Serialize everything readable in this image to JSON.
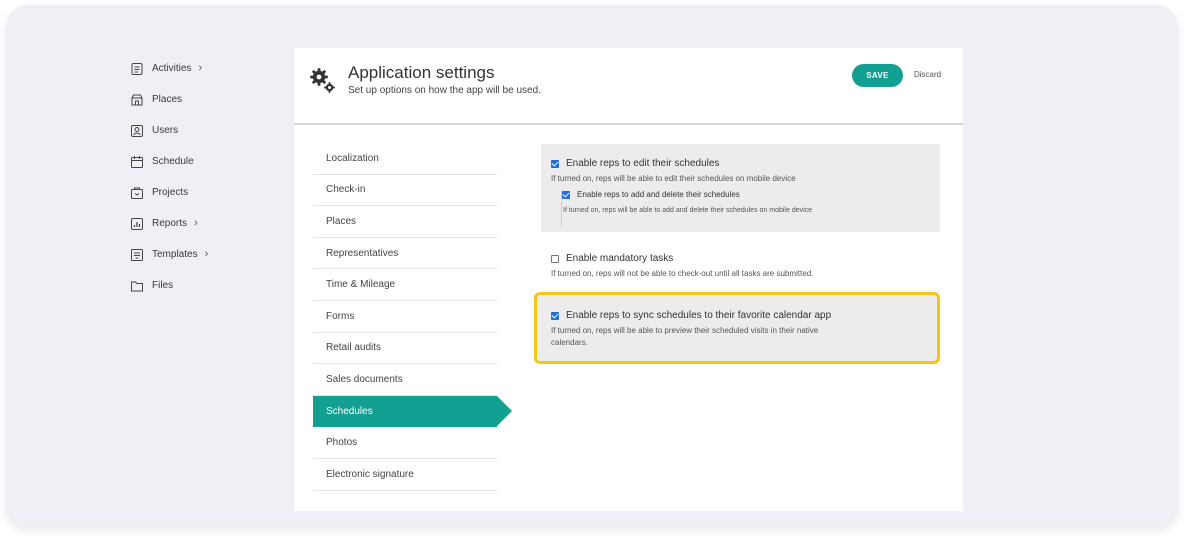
{
  "sidebar": {
    "items": [
      {
        "label": "Activities",
        "icon": "activities-icon",
        "has_submenu": true
      },
      {
        "label": "Places",
        "icon": "places-icon",
        "has_submenu": false
      },
      {
        "label": "Users",
        "icon": "users-icon",
        "has_submenu": false
      },
      {
        "label": "Schedule",
        "icon": "calendar-icon",
        "has_submenu": false
      },
      {
        "label": "Projects",
        "icon": "projects-icon",
        "has_submenu": false
      },
      {
        "label": "Reports",
        "icon": "reports-icon",
        "has_submenu": true
      },
      {
        "label": "Templates",
        "icon": "templates-icon",
        "has_submenu": true
      },
      {
        "label": "Files",
        "icon": "folder-icon",
        "has_submenu": false
      }
    ],
    "chevron": "›"
  },
  "header": {
    "title": "Application settings",
    "subtitle": "Set up options on how the app will be used.",
    "save_label": "SAVE",
    "discard_label": "Discard"
  },
  "settings_menu": {
    "items": [
      {
        "label": "Localization"
      },
      {
        "label": "Check-in"
      },
      {
        "label": "Places"
      },
      {
        "label": "Representatives"
      },
      {
        "label": "Time & Mileage"
      },
      {
        "label": "Forms"
      },
      {
        "label": "Retail audits"
      },
      {
        "label": "Sales documents"
      },
      {
        "label": "Schedules",
        "active": true
      },
      {
        "label": "Photos"
      },
      {
        "label": "Electronic signature"
      }
    ]
  },
  "options": {
    "edit_schedules": {
      "label": "Enable reps to edit their schedules",
      "description": "If turned on, reps will be able to edit their schedules on mobile device",
      "checked": true,
      "add_delete": {
        "label": "Enable reps to add and delete their schedules",
        "description": "If turned on, reps will be able to add and delete their schedules on mobile device",
        "checked": true
      }
    },
    "mandatory_tasks": {
      "label": "Enable mandatory tasks",
      "description": "If turned on, reps will not be able to check-out until all tasks are submitted.",
      "checked": false
    },
    "sync_calendar": {
      "label": "Enable reps to sync schedules to their favorite calendar app",
      "description_line1": "If turned on, reps will be able to preview their scheduled visits in their native",
      "description_line2": "calendars.",
      "checked": true,
      "highlighted": true
    }
  },
  "colors": {
    "accent": "#12a092",
    "highlight": "#f5c518",
    "checkbox": "#1f6fd6"
  }
}
